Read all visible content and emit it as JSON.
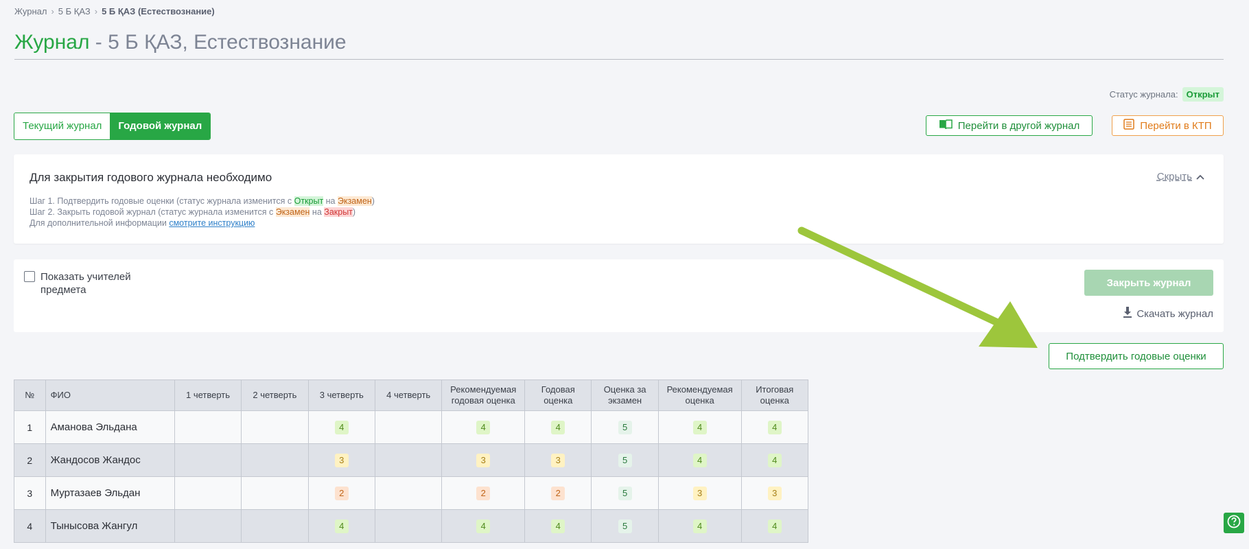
{
  "breadcrumb": {
    "items": [
      "Журнал",
      "5 Б ҚАЗ"
    ],
    "current": "5 Б ҚАЗ (Естествознание)"
  },
  "page": {
    "title_main": "Журнал",
    "title_rest": " - 5 Б ҚАЗ, Естествознание"
  },
  "status": {
    "label": "Статус журнала:",
    "value": "Открыт"
  },
  "tabs": {
    "current": "Текущий журнал",
    "annual": "Годовой журнал"
  },
  "buttons": {
    "other_journal": "Перейти в другой журнал",
    "ktp": "Перейти в КТП",
    "close_journal": "Закрыть журнал",
    "download": "Скачать журнал",
    "confirm": "Подтвердить годовые оценки"
  },
  "info": {
    "title": "Для закрытия годового журнала необходимо",
    "hide": "Скрыть",
    "step1_pre": "Шаг 1. Подтвердить годовые оценки (статус журнала изменится с ",
    "step1_from": "Открыт",
    "step1_mid": " на ",
    "step1_to": "Экзамен",
    "step1_post": ")",
    "step2_pre": "Шаг 2. Закрыть годовой журнал (статус журнала изменится с ",
    "step2_from": "Экзамен",
    "step2_mid": " на ",
    "step2_to": "Закрыт",
    "step2_post": ")",
    "step3_pre": "Для дополнительной информации ",
    "step3_link": "смотрите инструкцию"
  },
  "controls": {
    "show_teachers_line1": "Показать учителей",
    "show_teachers_line2": "предмета"
  },
  "table": {
    "headers": [
      "№",
      "ФИО",
      "1 четверть",
      "2 четверть",
      "3 четверть",
      "4 четверть",
      "Рекомендуемая годовая оценка",
      "Годовая оценка",
      "Оценка за экзамен",
      "Рекомендуемая оценка",
      "Итоговая оценка"
    ],
    "rows": [
      {
        "num": "1",
        "name": "Аманова Эльдана",
        "q1": "",
        "q2": "",
        "q3": "4",
        "q4": "",
        "rec_year": "4",
        "year": "4",
        "exam": "5",
        "rec": "4",
        "final": "4"
      },
      {
        "num": "2",
        "name": "Жандосов Жандос",
        "q1": "",
        "q2": "",
        "q3": "3",
        "q4": "",
        "rec_year": "3",
        "year": "3",
        "exam": "5",
        "rec": "4",
        "final": "4"
      },
      {
        "num": "3",
        "name": "Муртазаев Эльдан",
        "q1": "",
        "q2": "",
        "q3": "2",
        "q4": "",
        "rec_year": "2",
        "year": "2",
        "exam": "5",
        "rec": "3",
        "final": "3"
      },
      {
        "num": "4",
        "name": "Тынысова Жангул",
        "q1": "",
        "q2": "",
        "q3": "4",
        "q4": "",
        "rec_year": "4",
        "year": "4",
        "exam": "5",
        "rec": "4",
        "final": "4"
      }
    ]
  },
  "colors": {
    "primary": "#28a745",
    "ktp": "#e07b1a",
    "annotation_arrow": "#9dc63c"
  }
}
